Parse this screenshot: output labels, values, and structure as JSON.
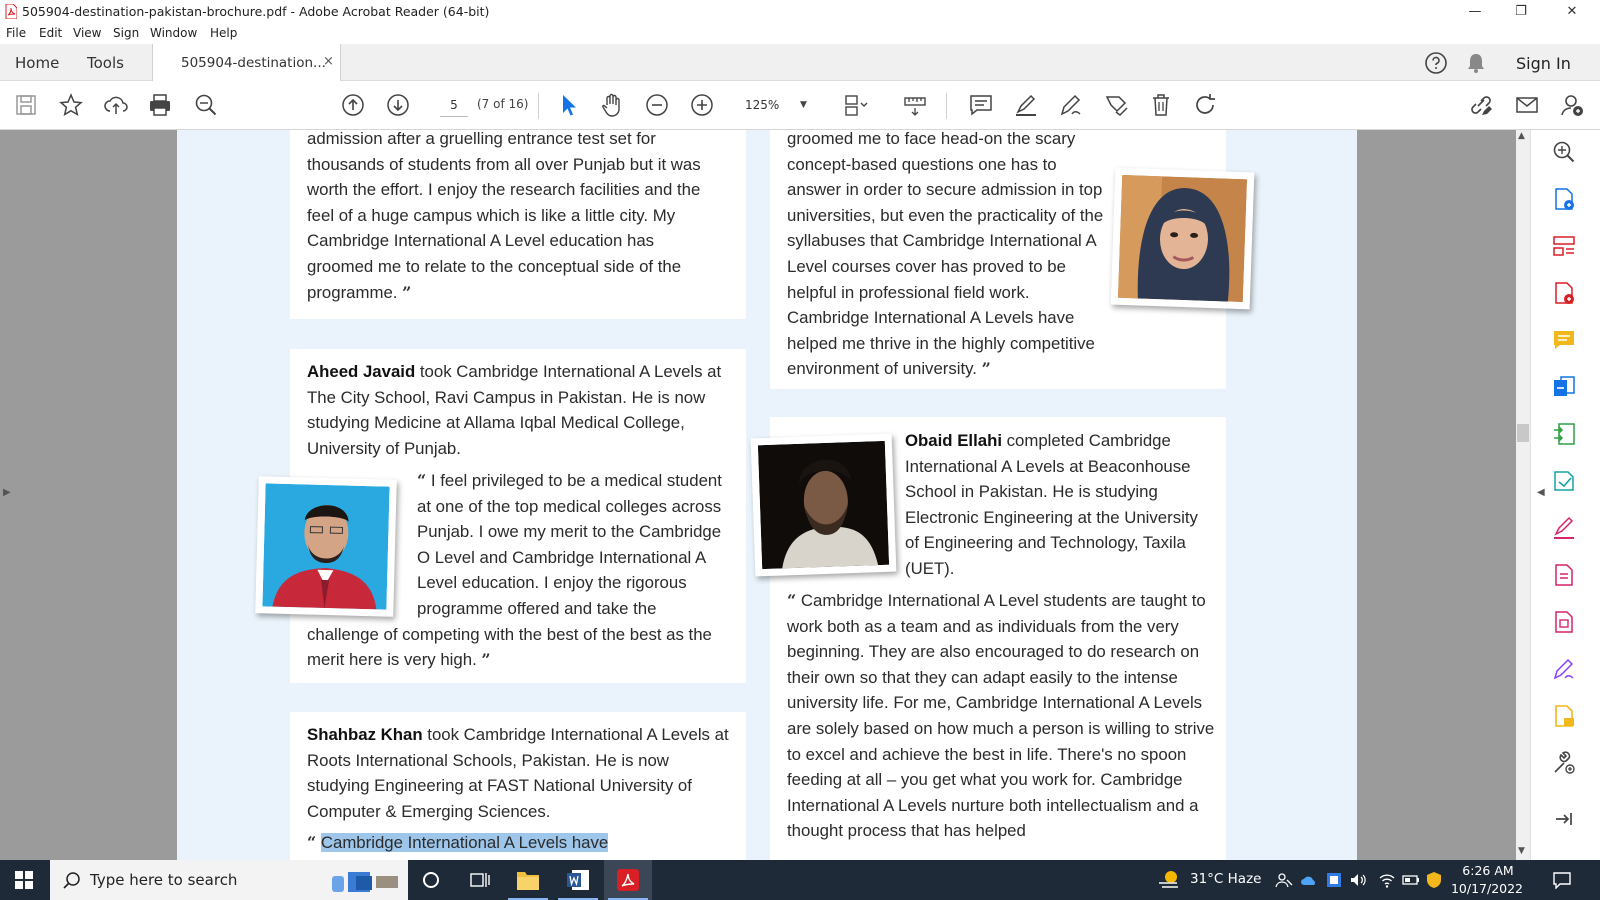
{
  "window": {
    "title": "505904-destination-pakistan-brochure.pdf - Adobe Acrobat Reader (64-bit)",
    "controls": [
      "—",
      "❐",
      "✕"
    ]
  },
  "menu": [
    "File",
    "Edit",
    "View",
    "Sign",
    "Window",
    "Help"
  ],
  "tabs": {
    "home": "Home",
    "tools": "Tools",
    "document": "505904-destination...",
    "close": "×",
    "sign_in": "Sign In"
  },
  "toolbar": {
    "page_current": "5",
    "page_of": "(7 of 16)",
    "zoom": "125%"
  },
  "document": {
    "card1_text": "admission after a gruelling entrance test set for thousands of students from all over Punjab but it was worth the effort. I enjoy the research facilities and the feel of a huge campus which is like a little city. My Cambridge International A Level education has groomed me to relate to the conceptual side of the programme.",
    "card2_name": "Aheed Javaid",
    "card2_intro": " took Cambridge International A Levels at The City School, Ravi Campus in Pakistan. He is now studying Medicine at Allama Iqbal Medical College, University of Punjab.",
    "card2_quote": "I feel privileged to be a medical student at one of the top medical colleges across Punjab. I owe my merit to the Cambridge O Level and Cambridge International A Level education. I enjoy the rigorous programme offered and take the challenge of competing with the best of the best as the merit here is very high.",
    "card3_name": "Shahbaz Khan",
    "card3_intro": " took Cambridge International A Levels at Roots International Schools, Pakistan. He is now studying Engineering at FAST National University of Computer & Emerging Sciences.",
    "card3_quote_start": "Cambridge International A Levels have",
    "card4_text": "groomed me to face head-on the scary concept-based questions one has to answer in order to secure admission in top universities, but even the practicality of the syllabuses that Cambridge International A Level courses cover has proved to be helpful in professional field work. Cambridge International A Levels have helped me thrive in the highly competitive environment of university.",
    "card5_name": "Obaid Ellahi",
    "card5_intro": " completed Cambridge International A Levels at Beaconhouse School in Pakistan. He is studying Electronic Engineering at the University of Engineering and Technology, Taxila (UET).",
    "card5_quote": "Cambridge International A Level students are taught to work both as a team and as individuals from the very beginning. They are also encouraged to do research on their own so that they can adapt easily to the intense university life. For me, Cambridge International A Levels are solely based on how much a person is willing to strive to excel and achieve the best in life. There's no spoon feeding at all – you get what you work for. Cambridge International A Levels nurture both intellectualism and a thought process that has helped",
    "open_quote": "“",
    "close_quote": "”"
  },
  "taskbar": {
    "search_placeholder": "Type here to search",
    "weather": "31°C  Haze",
    "time": "6:26 AM",
    "date": "10/17/2022"
  },
  "colors": {
    "page_bg": "#eaf3fb",
    "doc_bg": "#9b9b9b",
    "acrobat_red": "#d81f26",
    "accent_blue": "#1473e6",
    "taskbar": "#1f2a38"
  }
}
